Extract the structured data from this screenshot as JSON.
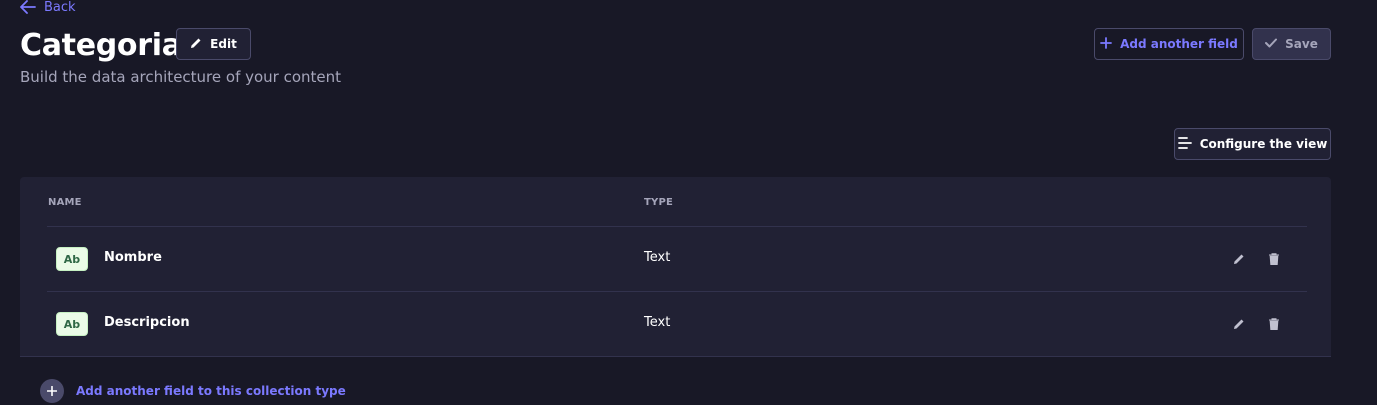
{
  "header": {
    "back_label": "Back",
    "title": "Categoria",
    "subtitle": "Build the data architecture of your content",
    "edit_label": "Edit",
    "add_field_label": "Add another field",
    "save_label": "Save"
  },
  "toolbar": {
    "configure_label": "Configure the view"
  },
  "table": {
    "columns": [
      "NAME",
      "TYPE"
    ],
    "rows": [
      {
        "badge": "Ab",
        "name": "Nombre",
        "type": "Text"
      },
      {
        "badge": "Ab",
        "name": "Descripcion",
        "type": "Text"
      }
    ]
  },
  "footer": {
    "add_link": "Add another field to this collection type"
  },
  "colors": {
    "accent": "#7b79ff",
    "background": "#181826",
    "card": "#212134",
    "badge_bg": "#eafbe7",
    "badge_text": "#2f6846"
  },
  "icons": [
    "arrow-left-icon",
    "pencil-icon",
    "plus-icon",
    "check-icon",
    "list-settings-icon",
    "trash-icon"
  ]
}
